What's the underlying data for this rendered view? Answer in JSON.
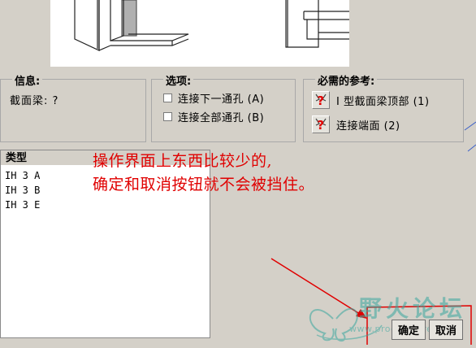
{
  "info": {
    "title": "信息:",
    "beam_label": "截面梁: ?"
  },
  "options": {
    "title": "选项:",
    "items": [
      "连接下一通孔 (A)",
      "连接全部通孔 (B)"
    ]
  },
  "references": {
    "title": "必需的参考:",
    "items": [
      "I 型截面梁顶部 (1)",
      "连接端面 (2)"
    ]
  },
  "type_list": {
    "header": "类型",
    "items": [
      "IH 3 A",
      "IH 3 B",
      "IH 3 E"
    ]
  },
  "annotation": {
    "line1": "操作界面上东西比较少的,",
    "line2": "确定和取消按钮就不会被挡住。"
  },
  "buttons": {
    "ok": "确定",
    "cancel": "取消"
  },
  "watermark": {
    "text": "野火论坛",
    "url": "www.proewildfire.cn"
  },
  "colors": {
    "annotation": "#e00000",
    "watermark": "#3aa8a0"
  }
}
